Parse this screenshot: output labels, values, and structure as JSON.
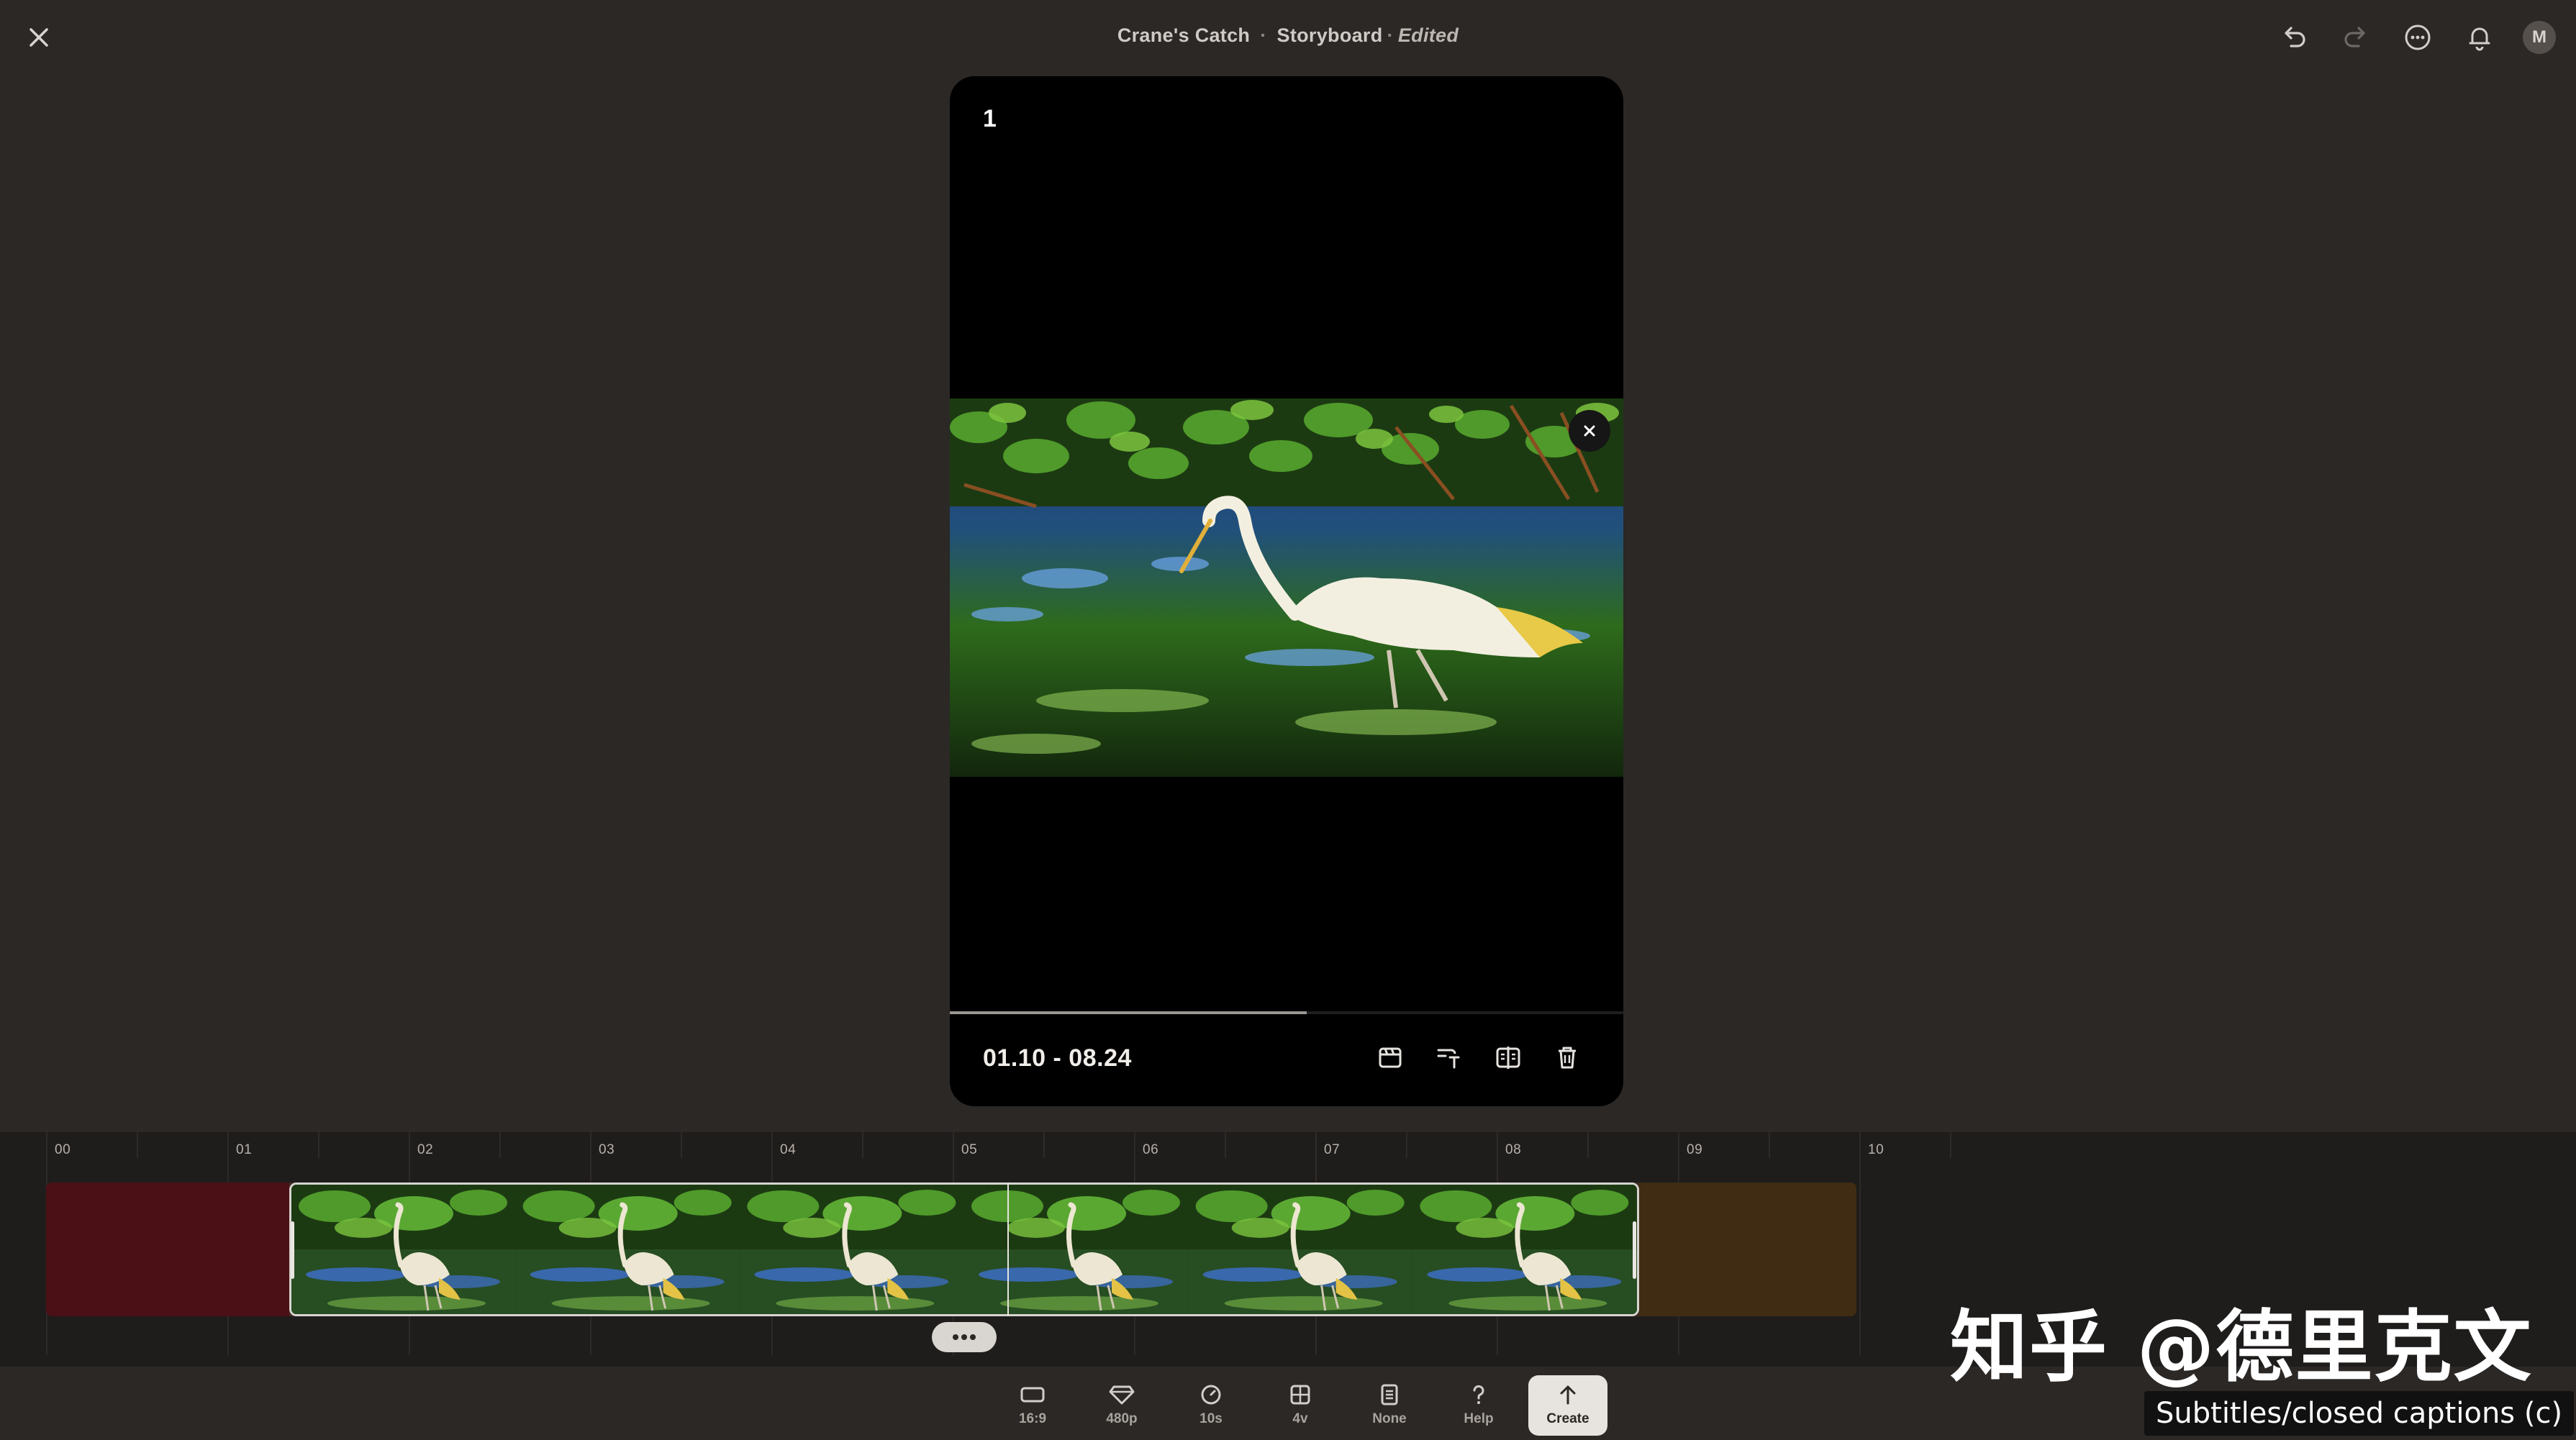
{
  "header": {
    "project": "Crane's Catch",
    "separator": "·",
    "view": "Storyboard",
    "status_sep": "·",
    "status": "Edited",
    "avatar_initial": "M"
  },
  "icons": {
    "close": "close-icon",
    "undo": "undo-icon",
    "redo": "redo-icon",
    "more": "more-icon",
    "notifications": "bell-icon"
  },
  "preview": {
    "card_index": "1",
    "time_range": "01.10 - 08.24",
    "playhead_progress": 0.53
  },
  "timeline": {
    "ticks": [
      "00",
      "01",
      "02",
      "03",
      "04",
      "05",
      "06",
      "07",
      "08",
      "09",
      "10"
    ],
    "clip_start_seconds": 1.1,
    "clip_end_seconds": 8.24
  },
  "toolbar": {
    "items": [
      {
        "label": "16:9",
        "icon": "aspect-ratio-icon"
      },
      {
        "label": "480p",
        "icon": "diamond-icon"
      },
      {
        "label": "10s",
        "icon": "clock-icon"
      },
      {
        "label": "4v",
        "icon": "grid-icon"
      },
      {
        "label": "None",
        "icon": "document-icon"
      },
      {
        "label": "Help",
        "icon": "question-icon"
      },
      {
        "label": "Create",
        "icon": "arrow-up-icon"
      }
    ]
  },
  "overlays": {
    "watermark": "知乎 @德里克文",
    "caption_tooltip": "Subtitles/closed captions (c)"
  },
  "colors": {
    "background": "#2b2826",
    "timeline_bg": "#1f1d1c",
    "left_segment": "#4a1016",
    "right_segment": "#3f2c13"
  }
}
